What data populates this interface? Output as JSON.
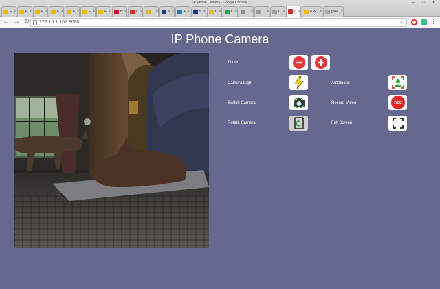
{
  "window": {
    "title": "IP Phone Camera - Google Chrome",
    "tabs": [
      {
        "title": "F",
        "favicon_color": "#f0b400"
      },
      {
        "title": "F",
        "favicon_color": "#f0b400"
      },
      {
        "title": "F",
        "favicon_color": "#f0b400"
      },
      {
        "title": "F",
        "favicon_color": "#f0b400"
      },
      {
        "title": "F",
        "favicon_color": "#f0b400"
      },
      {
        "title": "F",
        "favicon_color": "#f0b400"
      },
      {
        "title": "F",
        "favicon_color": "#f0b400"
      },
      {
        "title": "H",
        "favicon_color": "#c8102e"
      },
      {
        "title": "(",
        "favicon_color": "#d93025"
      },
      {
        "title": "T",
        "favicon_color": "#e8b030"
      },
      {
        "title": "S",
        "favicon_color": "#1a3a8a"
      },
      {
        "title": "4",
        "favicon_color": "#2a7ab0"
      },
      {
        "title": "S",
        "favicon_color": "#1a3a8a"
      },
      {
        "title": "C",
        "favicon_color": "#e8c000"
      },
      {
        "title": "C",
        "favicon_color": "#2aa84a"
      },
      {
        "title": "I",
        "favicon_color": "#8a8a8a"
      },
      {
        "title": "I",
        "favicon_color": "#9a9a9a"
      },
      {
        "title": "I",
        "favicon_color": "#a0a0a0"
      },
      {
        "title": "I",
        "favicon_color": "#c03030",
        "active": true
      },
      {
        "title": "4 W",
        "favicon_color": "#e8c000"
      },
      {
        "title": "[WP",
        "favicon_color": "#aaaaaa"
      }
    ]
  },
  "browser": {
    "url": "172.16.1.102:8080"
  },
  "page": {
    "title": "IP Phone Camera",
    "controls": {
      "zoom_label": "Zoom",
      "camera_light_label": "Camera Light",
      "autofocus_label": "Autofocus",
      "switch_camera_label": "Switch Camera",
      "record_video_label": "Record Video",
      "rotate_camera_label": "Rotate Camera",
      "full_screen_label": "Full Screen",
      "rec_badge": "REC"
    },
    "colors": {
      "background": "#676890",
      "zoom_red": "#e8343a",
      "flash_yellow": "#f5d600",
      "autofocus_green": "#2fa83a",
      "record_red": "#e8242a"
    }
  }
}
